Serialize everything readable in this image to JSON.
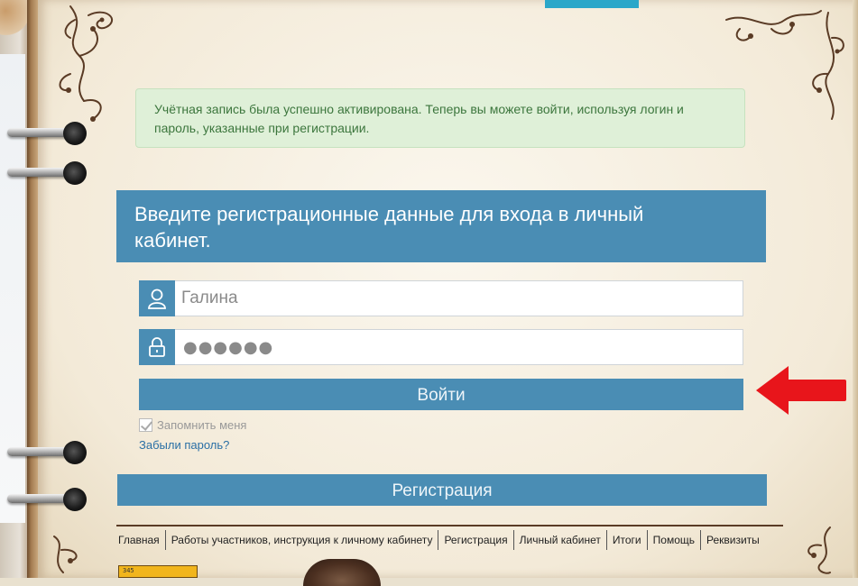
{
  "alert": {
    "line1": "Учётная запись была успешно активирована. Теперь вы можете войти, используя логин и",
    "line2": "пароль, указанные при регистрации."
  },
  "login": {
    "heading_line1": "Введите регистрационные данные для входа в личный",
    "heading_line2": "кабинет.",
    "username_placeholder": "Галина",
    "password_mask": "●●●●●●",
    "submit_label": "Войти",
    "remember_label": "Запомнить меня",
    "forgot_link": "Забыли пароль?",
    "register_label": "Регистрация"
  },
  "nav": {
    "items": [
      "Главная",
      "Работы участников, инструкция к личному кабинету",
      "Регистрация",
      "Личный кабинет",
      "Итоги",
      "Помощь",
      "Реквизиты"
    ]
  },
  "thumb": {
    "logo_text": "345"
  },
  "colors": {
    "primary": "#4a8db4",
    "alert_bg": "#dff0d8",
    "alert_text": "#3c763d",
    "accent_arrow": "#e8151b",
    "top_accent": "#2aa7c9"
  },
  "icons": {
    "username": "user-icon",
    "password": "lock-icon",
    "arrow": "red-arrow-left-icon"
  }
}
